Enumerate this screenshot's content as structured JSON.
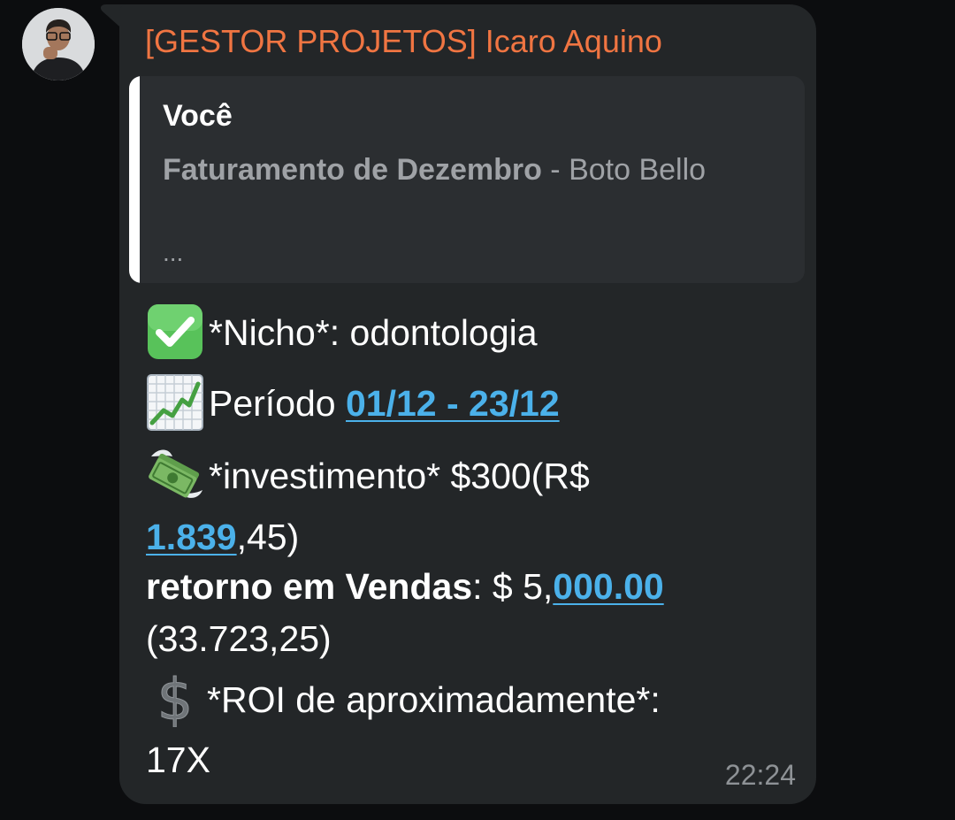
{
  "message": {
    "sender": "[GESTOR PROJETOS] Icaro Aquino",
    "time": "22:24",
    "colors": {
      "sender": "#f07542",
      "link": "#4bb1ea",
      "bubble": "#232628",
      "quote_bg": "#2b2e31",
      "background": "#0c0d0f"
    },
    "quote": {
      "author": "Você",
      "title": "Faturamento de Dezembro",
      "separator": " - ",
      "rest": "Boto Bello",
      "ellipsis": "..."
    },
    "lines": {
      "nicho": "*Nicho*: odontologia",
      "periodo_label": "Período ",
      "periodo_link": "01/12 - 23/12",
      "investimento": "*investimento* $300(R$",
      "investimento_link": "1.839",
      "investimento_rest": ",45)",
      "retorno_label": "retorno em Vendas",
      "retorno_prefix": ": $ 5,",
      "retorno_link": "000.00",
      "retorno_brl": "(33.723,25)",
      "roi": " *ROI de aproximadamente*:",
      "roi_value": "17X"
    },
    "emoji_icons": [
      "check-mark-button-icon",
      "chart-increasing-icon",
      "money-with-wings-icon",
      "heavy-dollar-sign-icon"
    ]
  }
}
